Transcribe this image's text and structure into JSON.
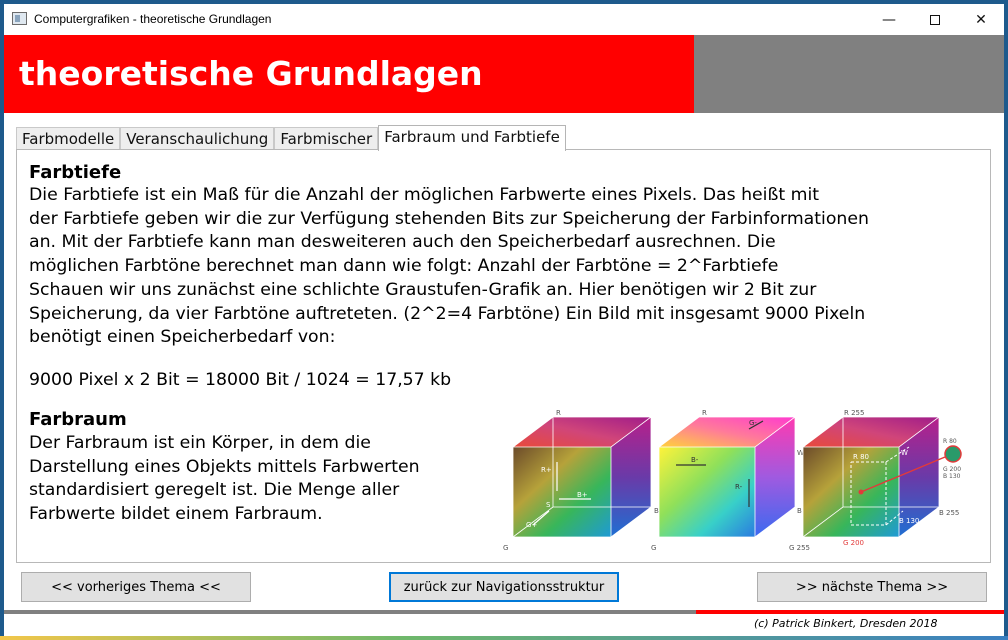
{
  "window": {
    "title": "Computergrafiken - theoretische Grundlagen",
    "minimize_glyph": "—",
    "close_glyph": "✕"
  },
  "header": {
    "title": "theoretische Grundlagen",
    "colors": {
      "accent": "#ff0000",
      "secondary": "#808080"
    }
  },
  "tabs": [
    {
      "label": "Farbmodelle"
    },
    {
      "label": "Veranschaulichung"
    },
    {
      "label": "Farbmischer"
    },
    {
      "label": "Farbraum und Farbtiefe",
      "active": true
    }
  ],
  "content": {
    "farbtiefe_heading": "Farbtiefe",
    "farbtiefe_text": "Die Farbtiefe ist ein Maß für die Anzahl der möglichen Farbwerte eines Pixels. Das heißt mit\nder Farbtiefe geben wir die zur Verfügung stehenden Bits zur Speicherung der Farbinformationen\nan. Mit der Farbtiefe kann man desweiteren auch den Speicherbedarf ausrechnen. Die\nmöglichen Farbtöne berechnet man dann wie folgt: Anzahl der Farbtöne = 2^Farbtiefe\nSchauen wir uns zunächst eine schlichte Graustufen-Grafik an. Hier benötigen wir 2 Bit zur\nSpeicherung, da vier Farbtöne auftreteten. (2^2=4 Farbtöne) Ein Bild mit insgesamt 9000 Pixeln\nbenötigt einen Speicherbedarf von:",
    "formula": "9000 Pixel x 2  Bit = 18000 Bit  / 1024 = 17,57 kb",
    "farbraum_heading": "Farbraum",
    "farbraum_text": "Der Farbraum ist ein Körper, in dem die\nDarstellung eines Objekts mittels Farbwerten\nstandardisiert  geregelt ist. Die  Menge aller\nFarbwerte bildet einem Farbraum."
  },
  "cube_labels": {
    "c1": {
      "r": "R",
      "w": "W",
      "s": "S",
      "b": "B",
      "g": "G",
      "arrow1": "B+",
      "arrow2": "R+",
      "arrow3": "G+"
    },
    "c2": {
      "r": "R",
      "w": "W",
      "s": "S",
      "b": "B",
      "g": "G",
      "arrow1": "B-",
      "arrow2": "R-",
      "arrow3": "G-"
    },
    "c3": {
      "r": "R 255",
      "r80": "R 80",
      "w": "W",
      "s": "S",
      "b255": "B 255",
      "b130": "B 130",
      "g255": "G 255",
      "g200": "G 200",
      "point": [
        "R 80",
        "G 200",
        "B 130"
      ]
    }
  },
  "buttons": {
    "prev": "<< vorheriges Thema <<",
    "back": "zurück zur Navigationsstruktur",
    "next": ">> nächste Thema >>"
  },
  "footer": {
    "copyright": "(c) Patrick Binkert, Dresden 2018"
  }
}
